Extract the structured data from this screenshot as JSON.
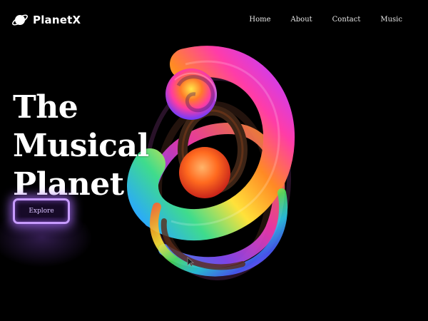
{
  "header": {
    "brand": "PlanetX",
    "logo_icon": "planet-icon",
    "nav": [
      {
        "label": "Home"
      },
      {
        "label": "About"
      },
      {
        "label": "Contact"
      },
      {
        "label": "Music"
      }
    ]
  },
  "hero": {
    "title_line1": "The Musical",
    "title_line2": "Planet",
    "cta_label": "Explore",
    "visual": "rainbow-spiral-sculpture"
  },
  "colors": {
    "background": "#000000",
    "text": "#ffffff",
    "accent_glow": "#c79bff"
  }
}
